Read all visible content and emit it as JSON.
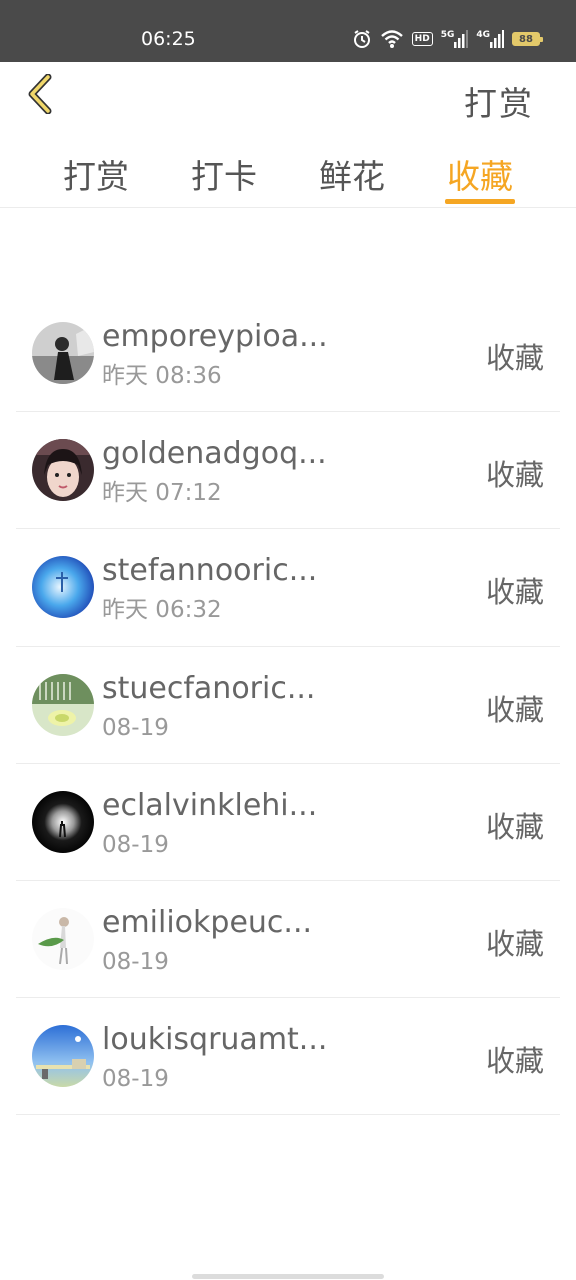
{
  "status_bar": {
    "time": "06:25",
    "icons": [
      "alarm-icon",
      "wifi-icon",
      "hd-icon",
      "signal-5g-icon",
      "signal-4g-icon",
      "battery-icon"
    ],
    "hd_label": "HD",
    "net1_label": "5G",
    "net2_label": "4G",
    "battery_level": "88",
    "battery_color": "#e3c96a"
  },
  "header": {
    "back_icon": "chevron-left-icon",
    "title": "打赏",
    "accent_color": "#f5a623"
  },
  "tabs": [
    {
      "label": "打赏",
      "active": false
    },
    {
      "label": "打卡",
      "active": false
    },
    {
      "label": "鲜花",
      "active": false
    },
    {
      "label": "收藏",
      "active": true
    }
  ],
  "items": [
    {
      "username": "emporeypioa...",
      "time": "昨天 08:36",
      "action": "收藏"
    },
    {
      "username": "goldenadgoq...",
      "time": "昨天 07:12",
      "action": "收藏"
    },
    {
      "username": "stefannooric...",
      "time": "昨天 06:32",
      "action": "收藏"
    },
    {
      "username": "stuecfanoric...",
      "time": "08-19",
      "action": "收藏"
    },
    {
      "username": "eclalvinklehi...",
      "time": "08-19",
      "action": "收藏"
    },
    {
      "username": "emiliokpeuc...",
      "time": "08-19",
      "action": "收藏"
    },
    {
      "username": "loukisqruamt...",
      "time": "08-19",
      "action": "收藏"
    }
  ]
}
